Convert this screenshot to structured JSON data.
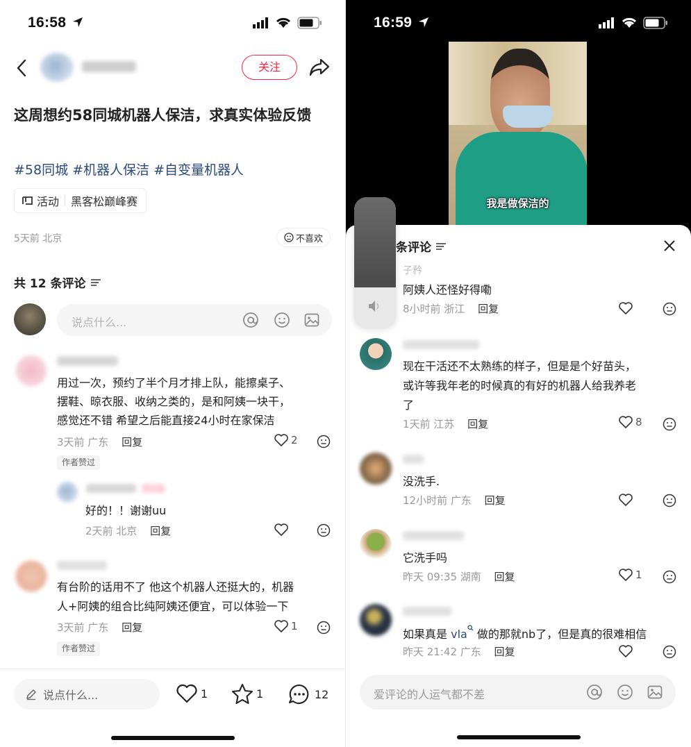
{
  "left": {
    "status_time": "16:58",
    "follow_label": "关注",
    "post_title": "这周想约58同城机器人保洁，求真实体验反馈",
    "hashtags": "#58同城 #机器人保洁 #自变量机器人",
    "activity_label": "活动",
    "activity_value": "黑客松巅峰赛",
    "post_meta": "5天前 北京",
    "dislike_label": "不喜欢",
    "comment_count_label": "共 12 条评论",
    "input_placeholder": "说点什么...",
    "comments": [
      {
        "text_lines": [
          "用过一次，预约了半个月才排上队，能擦桌子、",
          "摆鞋、晾衣服、收纳之类的，是和阿姨一块干，",
          "感觉还不错 希望之后能直接24小时在家保洁"
        ],
        "meta": "3天前 广东",
        "reply": "回复",
        "likes": "2",
        "badge": "作者赞过"
      },
      {
        "text": "好的！！谢谢uu",
        "meta": "2天前 北京",
        "reply": "回复"
      },
      {
        "text_lines": [
          "有台阶的话用不了 他这个机器人还挺大的，机器",
          "人+阿姨的组合比纯阿姨还便宜，可以体验一下"
        ],
        "meta": "3天前 广东",
        "reply": "回复",
        "likes": "1",
        "badge": "作者赞过"
      }
    ],
    "bottom_bar": {
      "placeholder": "说点什么...",
      "likes": "1",
      "stars": "1",
      "comments": "12"
    }
  },
  "right": {
    "status_time": "16:59",
    "video_caption": "我是做保洁的",
    "sheet_title": "条评论",
    "comments": [
      {
        "user": "子矜",
        "text": "阿姨人还怪好得嘞",
        "meta": "8小时前 浙江",
        "reply": "回复"
      },
      {
        "text_lines": [
          "现在干活还不太熟练的样子，但是是个好苗头，",
          "或许等我年老的时候真的有好的机器人给我养老",
          "了"
        ],
        "meta": "1天前 江苏",
        "reply": "回复",
        "likes": "8"
      },
      {
        "text": "没洗手.",
        "meta": "12小时前 广东",
        "reply": "回复"
      },
      {
        "text": "它洗手吗",
        "meta": "昨天 09:35 湖南",
        "reply": "回复",
        "likes": "1"
      },
      {
        "text_pre": "如果真是 ",
        "text_link": "vla",
        "text_post": " 做的那就nb了，但是真的很难相信",
        "meta": "昨天 21:42 广东",
        "reply": "回复"
      }
    ],
    "input_placeholder": "爱评论的人运气都不差"
  },
  "colors": {
    "accent_red": "#ff2442",
    "hashtag_blue": "#2b4a7a",
    "input_bg": "#f5f5f5"
  }
}
